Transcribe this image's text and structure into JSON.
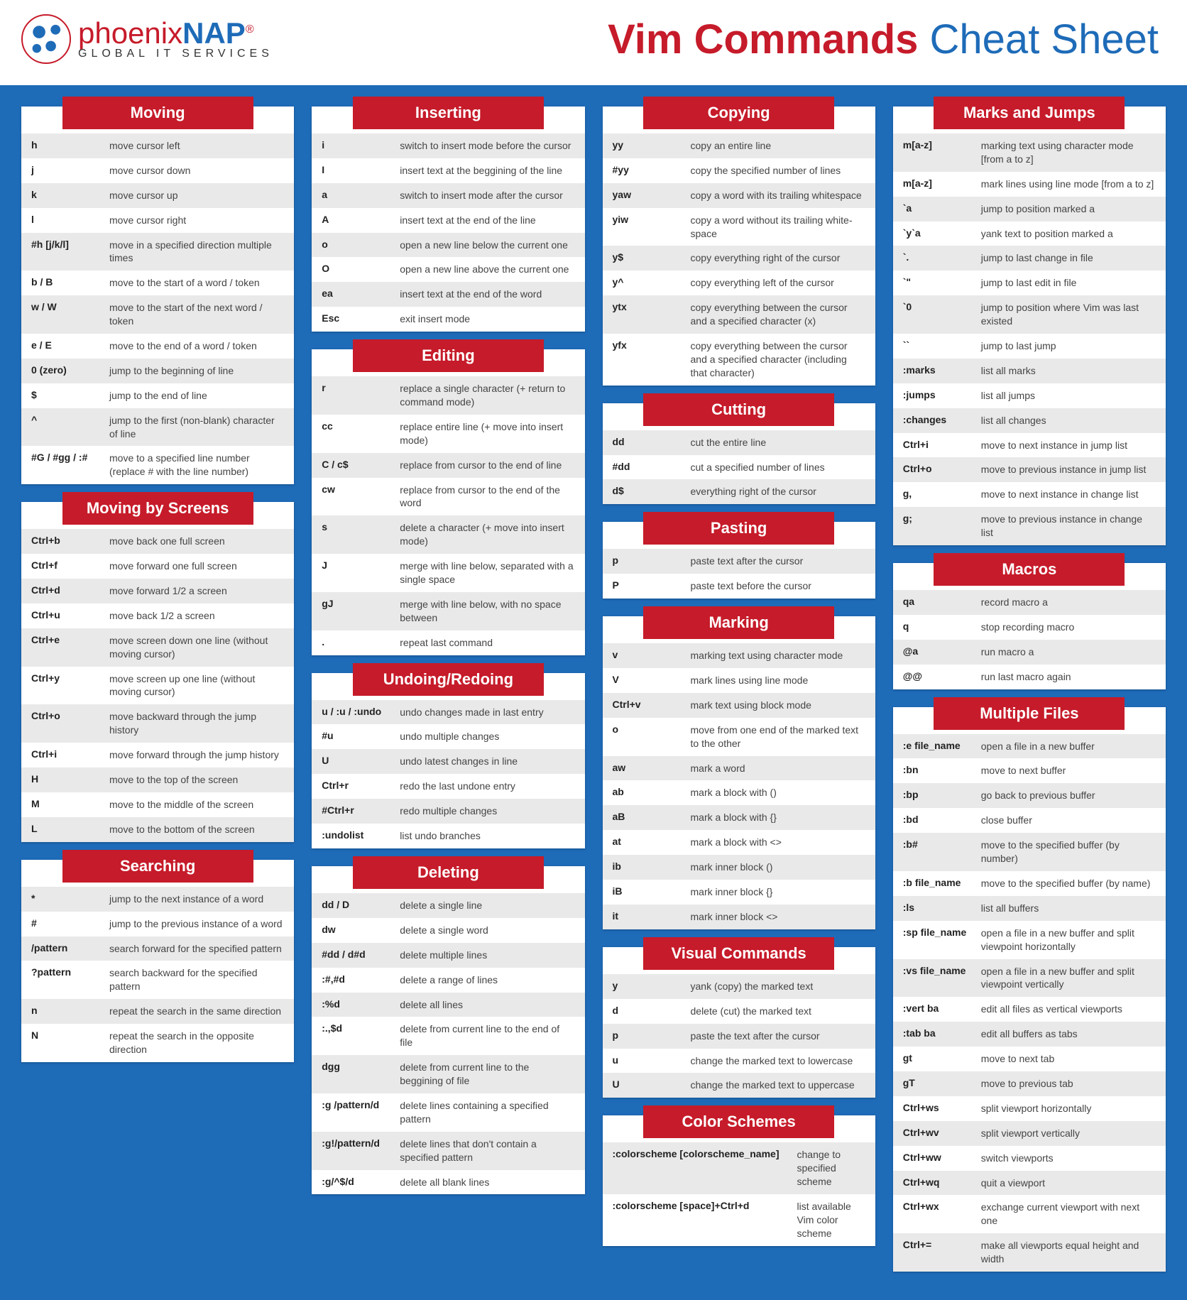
{
  "brand": {
    "p1": "phoenix",
    "p2": "NAP",
    "sub": "GLOBAL IT SERVICES"
  },
  "title": {
    "a": "Vim Commands",
    "b": "Cheat Sheet"
  },
  "columns": [
    [
      {
        "title": "Moving",
        "rows": [
          [
            "h",
            "move cursor left"
          ],
          [
            "j",
            "move cursor down"
          ],
          [
            "k",
            "move cursor up"
          ],
          [
            "l",
            "move cursor right"
          ],
          [
            "#h [j/k/l]",
            "move in a specified direction multiple times"
          ],
          [
            "b / B",
            "move to the start of a word / token"
          ],
          [
            "w / W",
            "move to the start of the next word / token"
          ],
          [
            "e / E",
            "move to the end of a word / token"
          ],
          [
            "0 (zero)",
            "jump to the beginning of line"
          ],
          [
            "$",
            "jump to the end of line"
          ],
          [
            "^",
            "jump to the first (non-blank) character of line"
          ],
          [
            "#G / #gg / :#",
            "move to a specified line number (replace # with the line number)"
          ]
        ]
      },
      {
        "title": "Moving by Screens",
        "rows": [
          [
            "Ctrl+b",
            "move back one full screen"
          ],
          [
            "Ctrl+f",
            "move forward one full screen"
          ],
          [
            "Ctrl+d",
            "move forward 1/2 a screen"
          ],
          [
            "Ctrl+u",
            "move back 1/2 a screen"
          ],
          [
            "Ctrl+e",
            "move screen down one line (without moving cursor)"
          ],
          [
            "Ctrl+y",
            "move screen up one line (without moving cursor)"
          ],
          [
            "Ctrl+o",
            "move backward through the jump history"
          ],
          [
            "Ctrl+i",
            "move forward through the jump history"
          ],
          [
            "H",
            "move to the top of the screen"
          ],
          [
            "M",
            "move to the middle of the screen"
          ],
          [
            "L",
            "move to the bottom of the screen"
          ]
        ]
      },
      {
        "title": "Searching",
        "rows": [
          [
            "*",
            "jump to the next instance of a word"
          ],
          [
            "#",
            "jump to the previous instance of a word"
          ],
          [
            "/pattern",
            "search forward for the specified pattern"
          ],
          [
            "?pattern",
            "search backward for the specified pattern"
          ],
          [
            "n",
            "repeat the search in the same direction"
          ],
          [
            "N",
            "repeat the search in the opposite direction"
          ]
        ]
      }
    ],
    [
      {
        "title": "Inserting",
        "rows": [
          [
            "i",
            "switch to insert mode before the cursor"
          ],
          [
            "I",
            "insert text at the beggining of the line"
          ],
          [
            "a",
            "switch to insert mode after the cursor"
          ],
          [
            "A",
            "insert text at the end of the line"
          ],
          [
            "o",
            "open a new line below the current one"
          ],
          [
            "O",
            "open a new line above the current one"
          ],
          [
            "ea",
            "insert text at the end of the word"
          ],
          [
            "Esc",
            "exit insert mode"
          ]
        ]
      },
      {
        "title": "Editing",
        "rows": [
          [
            "r",
            "replace a single character (+ return to command mode)"
          ],
          [
            "cc",
            "replace entire line (+ move into insert mode)"
          ],
          [
            "C / c$",
            "replace from cursor to the end of line"
          ],
          [
            "cw",
            "replace from cursor to the end of the word"
          ],
          [
            "s",
            "delete a character (+ move into insert mode)"
          ],
          [
            "J",
            "merge with line below, separated with a single space"
          ],
          [
            "gJ",
            "merge with line below, with no space between"
          ],
          [
            ".",
            "repeat last command"
          ]
        ]
      },
      {
        "title": "Undoing/Redoing",
        "rows": [
          [
            "u / :u / :undo",
            "undo changes made in last entry"
          ],
          [
            "#u",
            "undo multiple changes"
          ],
          [
            "U",
            "undo latest changes in line"
          ],
          [
            "Ctrl+r",
            "redo the last undone entry"
          ],
          [
            "#Ctrl+r",
            "redo multiple changes"
          ],
          [
            ":undolist",
            "list undo branches"
          ]
        ]
      },
      {
        "title": "Deleting",
        "rows": [
          [
            "dd / D",
            "delete a single line"
          ],
          [
            "dw",
            "delete a single word"
          ],
          [
            "#dd / d#d",
            "delete multiple lines"
          ],
          [
            ":#,#d",
            "delete a range of lines"
          ],
          [
            ":%d",
            "delete all lines"
          ],
          [
            ":.,$d",
            "delete from current line to the end of file"
          ],
          [
            "dgg",
            "delete from current line to the beggining of file"
          ],
          [
            ":g /pattern/d",
            "delete lines containing a specified pattern"
          ],
          [
            ":g!/pattern/d",
            "delete lines that don't contain a specified pattern"
          ],
          [
            ":g/^$/d",
            "delete all blank lines"
          ]
        ]
      }
    ],
    [
      {
        "title": "Copying",
        "rows": [
          [
            "yy",
            "copy an entire line"
          ],
          [
            "#yy",
            "copy the specified number of lines"
          ],
          [
            "yaw",
            "copy a word with its trailing whitespace"
          ],
          [
            "yiw",
            "copy a word without its trailing white-space"
          ],
          [
            "y$",
            "copy everything right of the cursor"
          ],
          [
            "y^",
            "copy everything left of the cursor"
          ],
          [
            "ytx",
            "copy everything between the cursor and a specified character (x)"
          ],
          [
            "yfx",
            "copy everything between the cursor and a specified character (including that character)"
          ]
        ]
      },
      {
        "title": "Cutting",
        "rows": [
          [
            "dd",
            "cut the entire line"
          ],
          [
            "#dd",
            "cut a specified number of lines"
          ],
          [
            "d$",
            "everything right of the cursor"
          ]
        ]
      },
      {
        "title": "Pasting",
        "rows": [
          [
            "p",
            "paste text after the cursor"
          ],
          [
            "P",
            "paste text before the cursor"
          ]
        ]
      },
      {
        "title": "Marking",
        "rows": [
          [
            "v",
            "marking text using character mode"
          ],
          [
            "V",
            "mark lines using line mode"
          ],
          [
            "Ctrl+v",
            "mark text using block mode"
          ],
          [
            "o",
            "move from one end of the marked text to the other"
          ],
          [
            "aw",
            "mark a word"
          ],
          [
            "ab",
            "mark a block with ()"
          ],
          [
            "aB",
            "mark a block with {}"
          ],
          [
            "at",
            "mark a block with <>"
          ],
          [
            "ib",
            "mark inner block ()"
          ],
          [
            "iB",
            "mark inner block {}"
          ],
          [
            "it",
            "mark inner block <>"
          ]
        ]
      },
      {
        "title": "Visual Commands",
        "rows": [
          [
            "y",
            "yank (copy) the marked text"
          ],
          [
            "d",
            "delete (cut) the marked text"
          ],
          [
            "p",
            "paste the text after the cursor"
          ],
          [
            "u",
            "change the marked text to lowercase"
          ],
          [
            "U",
            "change the marked text to uppercase"
          ]
        ]
      },
      {
        "title": "Color Schemes",
        "wide": true,
        "rows": [
          [
            ":colorscheme [colorscheme_name]",
            "change to specified scheme"
          ],
          [
            ":colorscheme [space]+Ctrl+d",
            "list available Vim color scheme"
          ]
        ]
      }
    ],
    [
      {
        "title": "Marks and Jumps",
        "rows": [
          [
            "m[a-z]",
            "marking text using character mode [from a to z]"
          ],
          [
            "m[a-z]",
            "mark lines using line mode [from a to z]"
          ],
          [
            "`a",
            "jump to position marked a"
          ],
          [
            "`y`a",
            "yank text to position marked a"
          ],
          [
            "`.",
            "jump to last change in file"
          ],
          [
            "`\"",
            "jump to last edit in file"
          ],
          [
            "`0",
            "jump to position where Vim was last existed"
          ],
          [
            "``",
            "jump to last jump"
          ],
          [
            ":marks",
            "list all marks"
          ],
          [
            ":jumps",
            "list all jumps"
          ],
          [
            ":changes",
            "list all changes"
          ],
          [
            "Ctrl+i",
            "move to next instance in jump list"
          ],
          [
            "Ctrl+o",
            "move to previous instance in jump list"
          ],
          [
            "g,",
            "move to next instance in change list"
          ],
          [
            "g;",
            "move to previous instance in change list"
          ]
        ]
      },
      {
        "title": "Macros",
        "rows": [
          [
            "qa",
            "record macro a"
          ],
          [
            "q",
            "stop recording macro"
          ],
          [
            "@a",
            "run macro a"
          ],
          [
            "@@",
            "run last macro again"
          ]
        ]
      },
      {
        "title": "Multiple Files",
        "rows": [
          [
            ":e file_name",
            "open a file in a new buffer"
          ],
          [
            ":bn",
            "move to next buffer"
          ],
          [
            ":bp",
            "go back to previous buffer"
          ],
          [
            ":bd",
            "close buffer"
          ],
          [
            ":b#",
            "move to the specified buffer (by number)"
          ],
          [
            ":b file_name",
            "move to the specified buffer (by name)"
          ],
          [
            ":ls",
            "list all buffers"
          ],
          [
            ":sp file_name",
            "open a file in a new buffer and split viewpoint horizontally"
          ],
          [
            ":vs file_name",
            "open a file in a new buffer and split viewpoint vertically"
          ],
          [
            ":vert ba",
            "edit all files as vertical viewports"
          ],
          [
            ":tab ba",
            "edit all buffers as tabs"
          ],
          [
            "gt",
            "move to next tab"
          ],
          [
            "gT",
            "move to previous tab"
          ],
          [
            "Ctrl+ws",
            "split viewport horizontally"
          ],
          [
            "Ctrl+wv",
            "split viewport vertically"
          ],
          [
            "Ctrl+ww",
            "switch viewports"
          ],
          [
            "Ctrl+wq",
            "quit a viewport"
          ],
          [
            "Ctrl+wx",
            "exchange current viewport with next one"
          ],
          [
            "Ctrl+=",
            "make all viewports equal height and width"
          ]
        ]
      }
    ]
  ]
}
